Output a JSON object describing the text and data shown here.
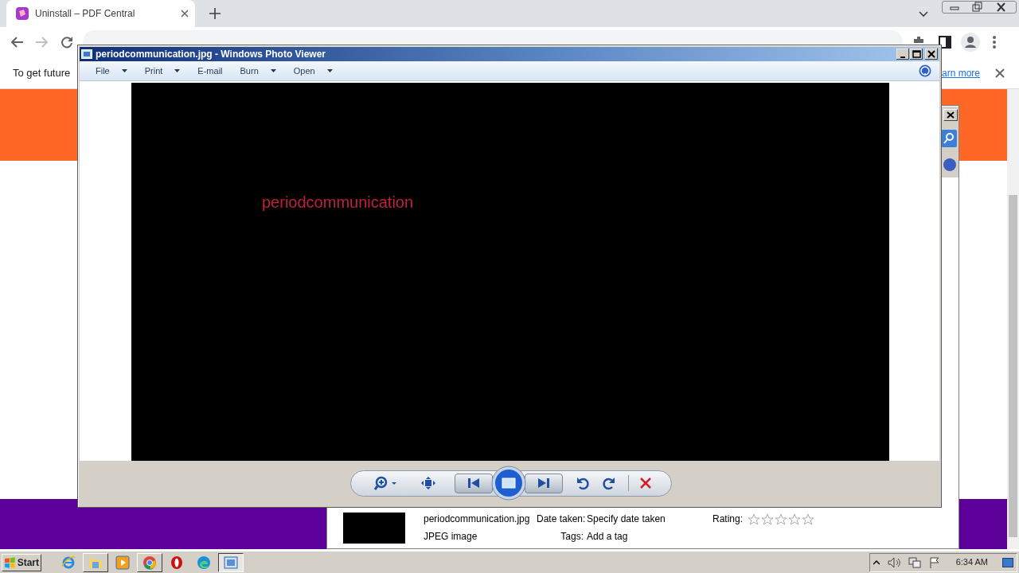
{
  "browser": {
    "tabs": [
      {
        "title": "Uninstall – PDF Central",
        "selected": true
      }
    ],
    "infobar": {
      "text": "To get future",
      "link": "arn more"
    }
  },
  "details_pane": {
    "file_name": "periodcommunication.jpg",
    "file_type": "JPEG image",
    "fields": [
      {
        "label": "Date taken:",
        "value": "Specify date taken"
      },
      {
        "label": "Tags:",
        "value": "Add a tag"
      }
    ],
    "rating": {
      "label": "Rating:",
      "stars": 0
    }
  },
  "photo_viewer": {
    "title": "periodcommunication.jpg - Windows Photo Viewer",
    "menu": [
      {
        "label": "File",
        "dropdown": true
      },
      {
        "label": "Print",
        "dropdown": true
      },
      {
        "label": "E-mail",
        "dropdown": false
      },
      {
        "label": "Burn",
        "dropdown": true
      },
      {
        "label": "Open",
        "dropdown": true
      }
    ],
    "image_text": "periodcommunication"
  },
  "taskbar": {
    "start": "Start",
    "apps": [
      {
        "kind": "ie",
        "running": false,
        "selected": false
      },
      {
        "kind": "folder",
        "running": true,
        "selected": false
      },
      {
        "kind": "media",
        "running": false,
        "selected": false
      },
      {
        "kind": "chrome",
        "running": true,
        "selected": false
      },
      {
        "kind": "opera",
        "running": false,
        "selected": false
      },
      {
        "kind": "edge",
        "running": false,
        "selected": false
      },
      {
        "kind": "viewer",
        "running": true,
        "selected": true
      }
    ],
    "clock": "6:34 AM"
  }
}
